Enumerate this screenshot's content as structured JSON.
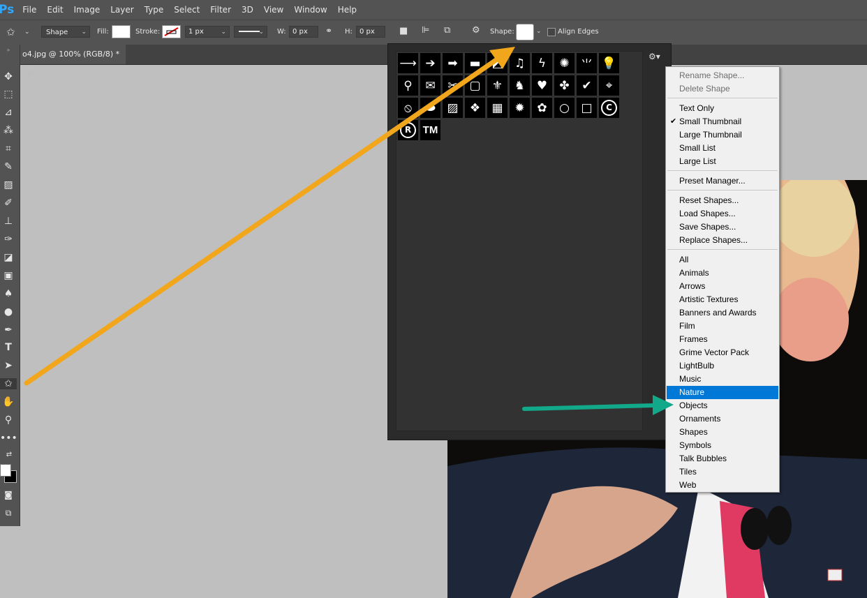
{
  "app": {
    "logo": "Ps",
    "accent_color": "#31a8ff"
  },
  "menu_bar": [
    "File",
    "Edit",
    "Image",
    "Layer",
    "Type",
    "Select",
    "Filter",
    "3D",
    "View",
    "Window",
    "Help"
  ],
  "options_bar": {
    "mode": "Shape",
    "fill_label": "Fill:",
    "stroke_label": "Stroke:",
    "stroke_width": "1 px",
    "w_label": "W:",
    "w_value": "0 px",
    "h_label": "H:",
    "h_value": "0 px",
    "shape_label": "Shape:",
    "align_edges_label": "Align Edges"
  },
  "document_tab": {
    "title": "o4.jpg @ 100% (RGB/8) *",
    "close": "×"
  },
  "shape_picker": {
    "shapes": [
      "arrow-thin",
      "arrow",
      "arrow-bold",
      "banner",
      "frame",
      "music-note",
      "lightning",
      "burst",
      "grass",
      "lightbulb",
      "bone",
      "envelope",
      "scissors",
      "square-frame",
      "fleur-de-lis",
      "cat",
      "heart",
      "puzzle",
      "checkmark",
      "target",
      "no-sign",
      "speech-bubble",
      "diagonal-lines",
      "diamond-grid",
      "grid",
      "starburst",
      "paw",
      "circle",
      "square",
      "copyright",
      "registered",
      "trademark"
    ],
    "registered_text": "R",
    "trademark_text": "TM",
    "copyright_text": "C"
  },
  "context_menu": {
    "group_edit": [
      {
        "label": "Rename Shape...",
        "enabled": false
      },
      {
        "label": "Delete Shape",
        "enabled": false
      }
    ],
    "group_view": [
      {
        "label": "Text Only",
        "checked": false
      },
      {
        "label": "Small Thumbnail",
        "checked": true
      },
      {
        "label": "Large Thumbnail",
        "checked": false
      },
      {
        "label": "Small List",
        "checked": false
      },
      {
        "label": "Large List",
        "checked": false
      }
    ],
    "group_manager": [
      "Preset Manager..."
    ],
    "group_io": [
      "Reset Shapes...",
      "Load Shapes...",
      "Save Shapes...",
      "Replace Shapes..."
    ],
    "group_sets": [
      "All",
      "Animals",
      "Arrows",
      "Artistic Textures",
      "Banners and Awards",
      "Film",
      "Frames",
      "Grime Vector Pack",
      "LightBulb",
      "Music",
      "Nature",
      "Objects",
      "Ornaments",
      "Shapes",
      "Symbols",
      "Talk Bubbles",
      "Tiles",
      "Web"
    ],
    "highlighted": "Nature",
    "checkmark": "✔"
  },
  "annotations": {
    "orange_arrow_color": "#f2a61b",
    "teal_arrow_color": "#11a98a"
  }
}
